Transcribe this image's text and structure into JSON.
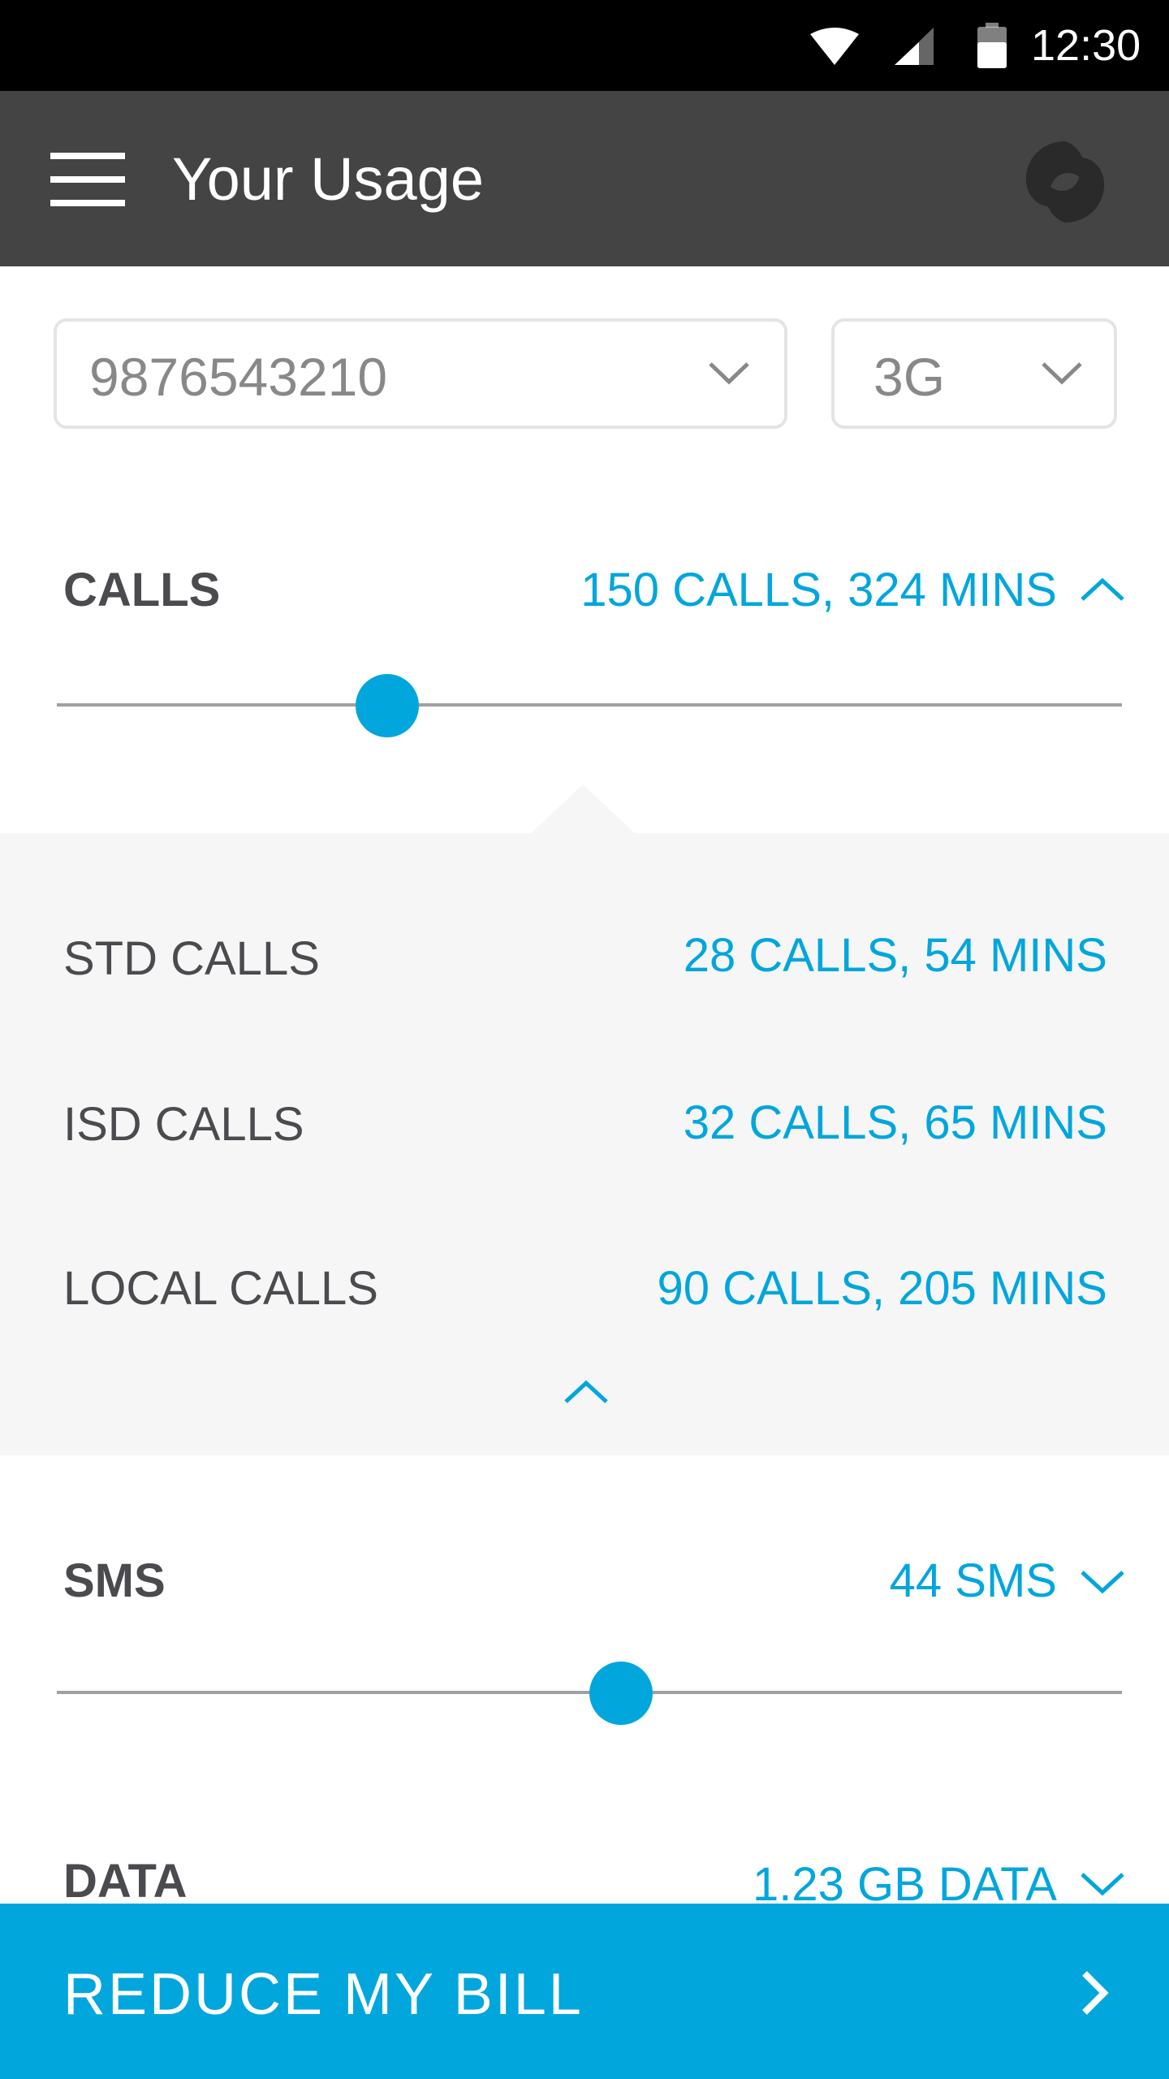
{
  "status_bar": {
    "time": "12:30",
    "icons": [
      "wifi-icon",
      "cell-signal-icon",
      "battery-icon"
    ]
  },
  "app_bar": {
    "title": "Your Usage",
    "menu_icon": "hamburger-menu-icon",
    "logo_icon": "brand-logo-icon"
  },
  "filters": {
    "number": {
      "value": "9876543210"
    },
    "network": {
      "value": "3G"
    }
  },
  "usage": {
    "calls": {
      "label": "CALLS",
      "summary": "150 CALLS, 324 MINS",
      "expanded": true,
      "slider_fraction": 0.31,
      "breakdown": [
        {
          "label": "STD CALLS",
          "value": "28 CALLS, 54 MINS"
        },
        {
          "label": "ISD CALLS",
          "value": "32 CALLS, 65 MINS"
        },
        {
          "label": "LOCAL CALLS",
          "value": "90 CALLS, 205 MINS"
        }
      ]
    },
    "sms": {
      "label": "SMS",
      "summary": "44 SMS",
      "expanded": false,
      "slider_fraction": 0.53
    },
    "data": {
      "label": "DATA",
      "summary": "1.23 GB DATA",
      "expanded": false
    }
  },
  "cta": {
    "label": "REDUCE MY BILL"
  },
  "colors": {
    "accent": "#00a6dc",
    "app_bar": "#444444",
    "status_bar": "#000000",
    "text_dark": "#4a4a4f",
    "panel_bg": "#f6f6f6"
  }
}
